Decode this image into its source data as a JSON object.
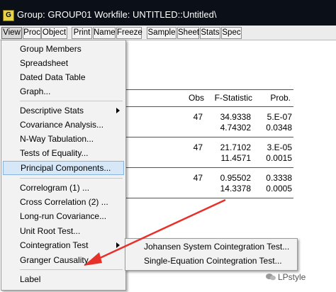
{
  "window": {
    "app_icon_letter": "G",
    "title": "Group: GROUP01   Workfile: UNTITLED::Untitled\\"
  },
  "toolbar": {
    "buttons": [
      "View",
      "Proc",
      "Object",
      "Print",
      "Name",
      "Freeze",
      "Sample",
      "Sheet",
      "Stats",
      "Spec"
    ]
  },
  "table": {
    "headers": {
      "obs": "Obs",
      "fstat": "F-Statistic",
      "prob": "Prob."
    },
    "rows": [
      {
        "obs": "47",
        "f1": "34.9338",
        "p1": "5.E-07",
        "f2": "4.74302",
        "p2": "0.0348"
      },
      {
        "obs": "47",
        "f1": "21.7102",
        "p1": "3.E-05",
        "f2": "11.4571",
        "p2": "0.0015"
      },
      {
        "obs": "47",
        "f1": "0.95502",
        "p1": "0.3338",
        "f2": "14.3378",
        "p2": "0.0005"
      }
    ]
  },
  "menu": {
    "items": [
      "Group Members",
      "Spreadsheet",
      "Dated Data Table",
      "Graph...",
      "Descriptive Stats",
      "Covariance Analysis...",
      "N-Way Tabulation...",
      "Tests of Equality...",
      "Principal Components...",
      "Correlogram (1) ...",
      "Cross Correlation (2) ...",
      "Long-run Covariance...",
      "Unit Root Test...",
      "Cointegration Test",
      "Granger Causality...",
      "Label"
    ]
  },
  "submenu": {
    "items": [
      "Johansen System Cointegration Test...",
      "Single-Equation Cointegration Test..."
    ]
  },
  "annotation": {
    "arrow_color": "#e8302a"
  },
  "watermark": {
    "text": "LPstyle"
  }
}
